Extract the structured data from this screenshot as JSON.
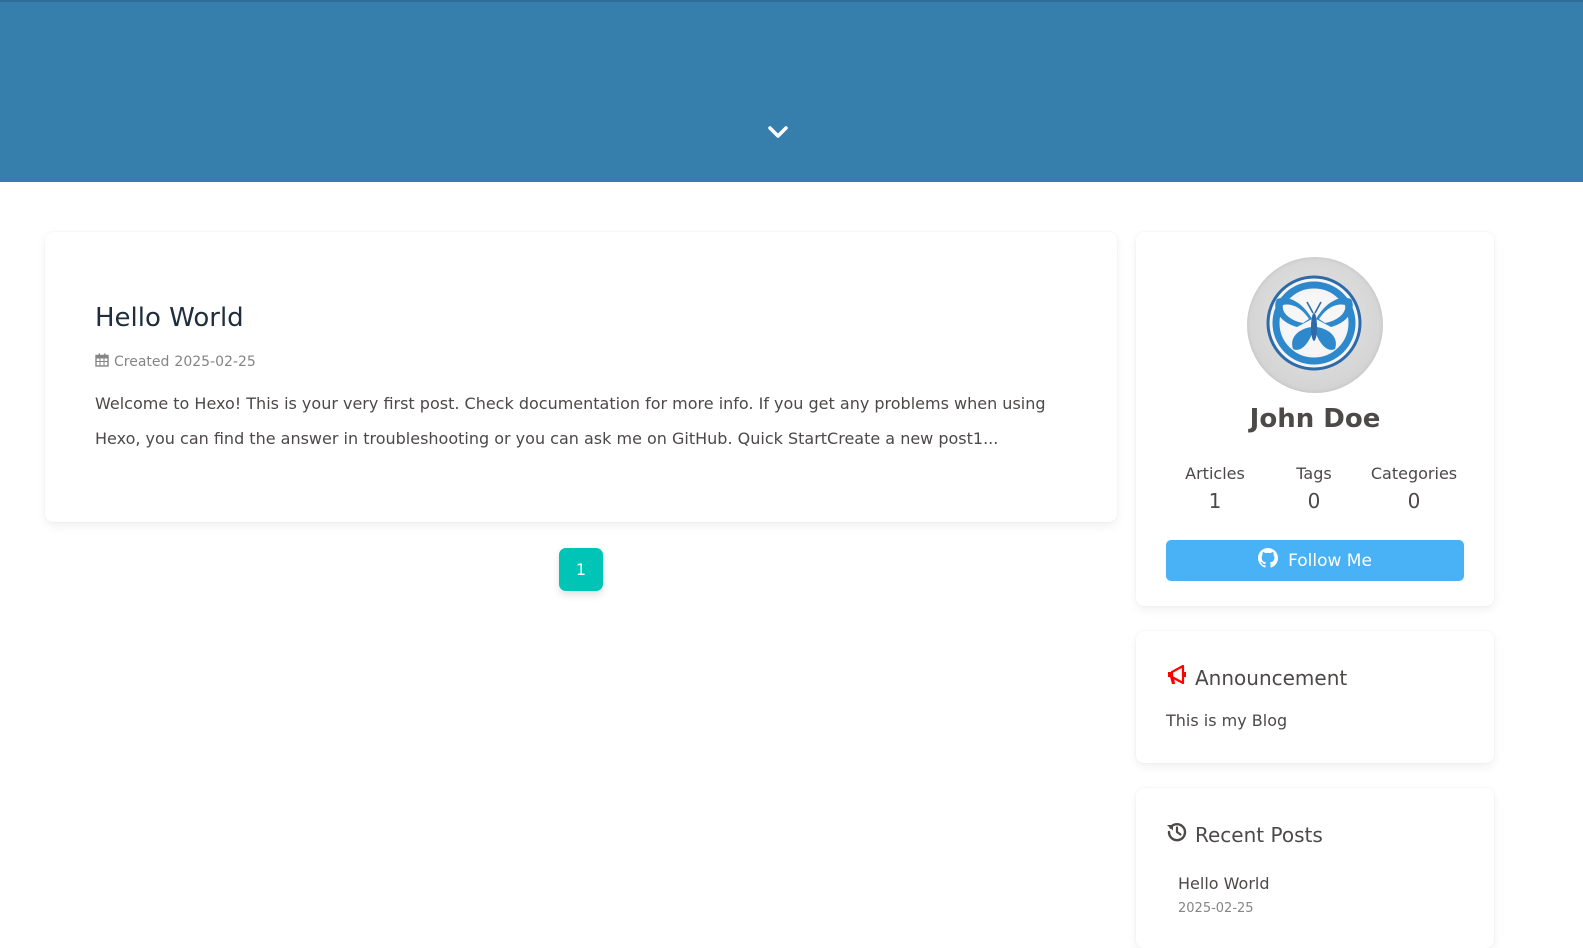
{
  "header": {
    "scroll_icon": "chevron-down-icon",
    "background_color": "#367fad"
  },
  "post": {
    "title": "Hello World",
    "meta_icon": "calendar-icon",
    "created_label": "Created",
    "created_date": "2025-02-25",
    "excerpt": "Welcome to Hexo! This is your very first post. Check documentation for more info. If you get any problems when using Hexo, you can find the answer in troubleshooting or you can ask me on GitHub. Quick StartCreate a new post1..."
  },
  "pagination": {
    "current_page": "1",
    "accent_color": "#00c4b6"
  },
  "author": {
    "avatar_icon": "butterfly-logo",
    "name": "John Doe",
    "stats": [
      {
        "label": "Articles",
        "count": "1"
      },
      {
        "label": "Tags",
        "count": "0"
      },
      {
        "label": "Categories",
        "count": "0"
      }
    ],
    "follow_label": "Follow Me",
    "follow_icon": "github-icon",
    "follow_color": "#49b1f5"
  },
  "announcement": {
    "icon": "bullhorn-icon",
    "title": "Announcement",
    "text": "This is my Blog"
  },
  "recent_posts": {
    "icon": "history-icon",
    "title": "Recent Posts",
    "items": [
      {
        "title": "Hello World",
        "date": "2025-02-25"
      }
    ]
  }
}
